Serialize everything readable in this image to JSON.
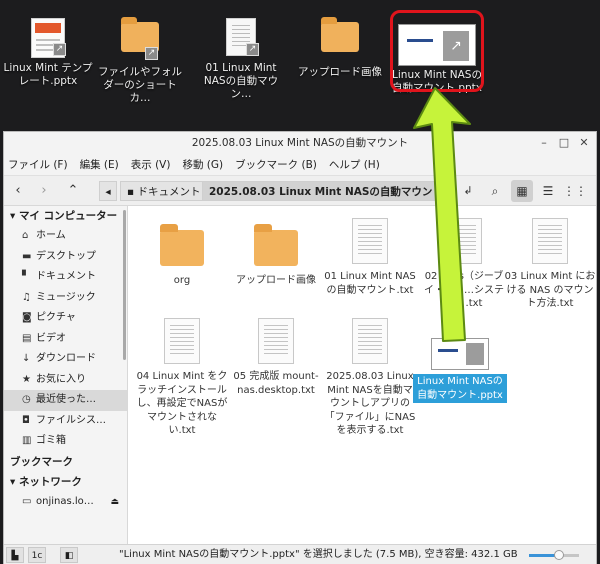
{
  "desktop": {
    "icons": [
      {
        "label": "Linux Mint テンプレート.pptx",
        "kind": "presentation"
      },
      {
        "label": "ファイルやフォルダーのショートカ…",
        "kind": "folder-link"
      },
      {
        "label": "01 Linux Mint NASの自動マウン…",
        "kind": "text-link"
      },
      {
        "label": "アップロード画像",
        "kind": "folder"
      },
      {
        "label": "Linux Mint NASの自動マウント.pptx",
        "kind": "presentation-selected"
      }
    ]
  },
  "window": {
    "title": "2025.08.03 Linux Mint NASの自動マウント",
    "menu": [
      "ファイル (F)",
      "編集 (E)",
      "表示 (V)",
      "移動 (G)",
      "ブックマーク (B)",
      "ヘルプ (H)"
    ],
    "breadcrumbs": [
      "ドキュメント",
      "2025.08.03 Linux Mint NASの自動マウント"
    ]
  },
  "sidebar": {
    "sections": [
      {
        "heading": "マイ コンピューター",
        "items": [
          {
            "label": "ホーム",
            "icon": "home-icon"
          },
          {
            "label": "デスクトップ",
            "icon": "desktop-icon"
          },
          {
            "label": "ドキュメント",
            "icon": "document-icon"
          },
          {
            "label": "ミュージック",
            "icon": "music-icon"
          },
          {
            "label": "ピクチャ",
            "icon": "camera-icon"
          },
          {
            "label": "ビデオ",
            "icon": "video-icon"
          },
          {
            "label": "ダウンロード",
            "icon": "download-icon"
          },
          {
            "label": "お気に入り",
            "icon": "star-icon"
          },
          {
            "label": "最近使った…",
            "icon": "clock-icon"
          },
          {
            "label": "ファイルシス…",
            "icon": "drive-icon"
          },
          {
            "label": "ゴミ箱",
            "icon": "trash-icon"
          }
        ]
      },
      {
        "heading": "ブックマーク",
        "items": []
      },
      {
        "heading": "ネットワーク",
        "items": [
          {
            "label": "onjinas.lo…",
            "icon": "network-drive-icon"
          }
        ]
      }
    ]
  },
  "files": [
    {
      "label": "org",
      "kind": "folder"
    },
    {
      "label": "アップロード画像",
      "kind": "folder"
    },
    {
      "label": "01 Linux Mint NASの自動マウント.txt",
      "kind": "text"
    },
    {
      "label": "02 GVfs（ジーブイ・ファ…システム）.txt",
      "kind": "text"
    },
    {
      "label": "03 Linux Mint における NAS のマウント方法.txt",
      "kind": "text"
    },
    {
      "label": "04 Linux Mint をクラッチインストールし、再設定でNASがマウントされない.txt",
      "kind": "text"
    },
    {
      "label": "05 完成版 mount-nas.desktop.txt",
      "kind": "text"
    },
    {
      "label": "2025.08.03 Linux Mint NASを自動マウントしアプリの「ファイル」にNASを表示する.txt",
      "kind": "text"
    },
    {
      "label": "Linux Mint NASの自動マウント.pptx",
      "kind": "presentation",
      "selected": true
    }
  ],
  "status": {
    "text": "\"Linux Mint NASの自動マウント.pptx\" を選択しました (7.5 MB), 空き容量: 432.1 GB",
    "zoom_fraction": 0.6
  },
  "colors": {
    "highlight": "#e0141c",
    "arrow": "#c6f33a",
    "selection": "#2d9fd9"
  }
}
